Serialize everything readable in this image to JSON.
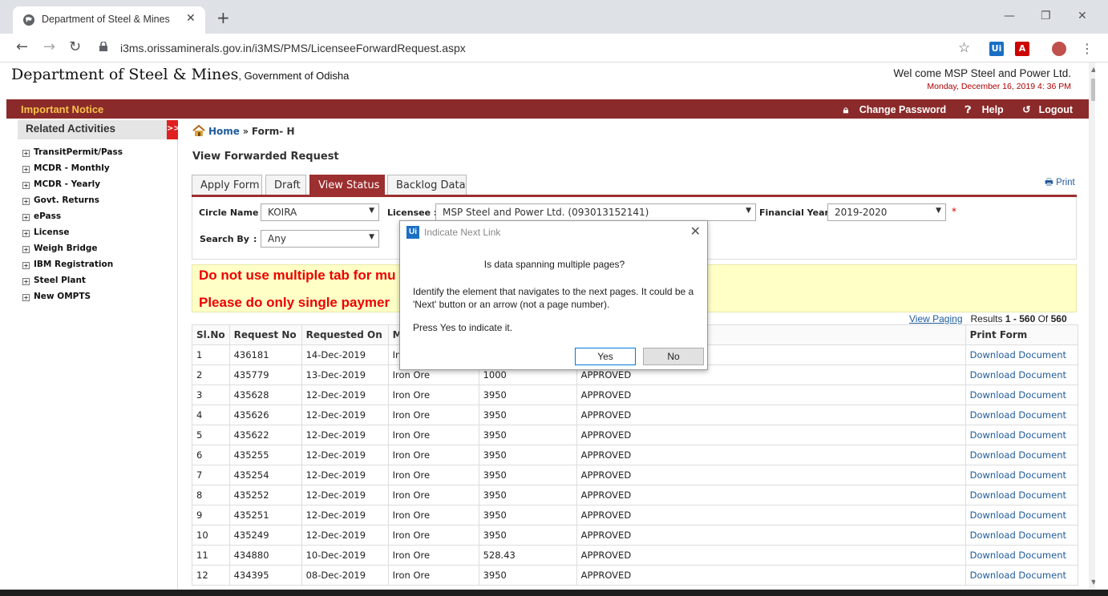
{
  "browser": {
    "tab_title": "Department of Steel & Mines",
    "url": "i3ms.orissaminerals.gov.in/i3MS/PMS/LicenseeForwardRequest.aspx"
  },
  "header": {
    "site_title": "Department of Steel & Mines",
    "site_sub": ", Government of Odisha",
    "welcome": "Wel come MSP Steel and Power Ltd.",
    "date": "Monday, December 16, 2019  4: 36 PM"
  },
  "redbar": {
    "notice": "Important Notice",
    "change_password": "Change Password",
    "help": "Help",
    "logout": "Logout"
  },
  "sidebar": {
    "heading": "Related Activities",
    "toggle": ">>",
    "items": [
      "TransitPermit/Pass",
      "MCDR - Monthly",
      "MCDR - Yearly",
      "Govt. Returns",
      "ePass",
      "License",
      "Weigh Bridge",
      "IBM Registration",
      "Steel Plant",
      "New OMPTS"
    ]
  },
  "breadcrumb": {
    "home": "Home",
    "sep": " » ",
    "current": "Form- H"
  },
  "page_title": "View Forwarded Request",
  "tabs": [
    "Apply Form",
    "Draft",
    "View Status",
    "Backlog Data"
  ],
  "print": "Print",
  "filters": {
    "circle_label": "Circle Name :",
    "circle_value": "KOIRA",
    "licensee_label": "Licensee :",
    "licensee_value": "MSP Steel and Power Ltd. (093013152141)",
    "fy_label": "Financial Year :",
    "fy_value": "2019-2020",
    "search_label": "Search By",
    "search_colon": ":",
    "search_value": "Any",
    "required": "*"
  },
  "warnings": {
    "line1": "Do not use multiple tab for mu",
    "line2": "Please do only single paymer"
  },
  "results": {
    "view_paging": "View Paging",
    "prefix": "Results",
    "from": "1",
    "dash": " - ",
    "to": "560",
    "of": "Of",
    "total": "560"
  },
  "table": {
    "headers": [
      "Sl.No",
      "Request No",
      "Requested On",
      "M",
      "",
      "",
      "Print Form"
    ],
    "rows": [
      [
        "1",
        "436181",
        "14-Dec-2019",
        "Ir",
        "",
        "",
        "Download Document"
      ],
      [
        "2",
        "435779",
        "13-Dec-2019",
        "Iron Ore",
        "1000",
        "APPROVED",
        "Download Document"
      ],
      [
        "3",
        "435628",
        "12-Dec-2019",
        "Iron Ore",
        "3950",
        "APPROVED",
        "Download Document"
      ],
      [
        "4",
        "435626",
        "12-Dec-2019",
        "Iron Ore",
        "3950",
        "APPROVED",
        "Download Document"
      ],
      [
        "5",
        "435622",
        "12-Dec-2019",
        "Iron Ore",
        "3950",
        "APPROVED",
        "Download Document"
      ],
      [
        "6",
        "435255",
        "12-Dec-2019",
        "Iron Ore",
        "3950",
        "APPROVED",
        "Download Document"
      ],
      [
        "7",
        "435254",
        "12-Dec-2019",
        "Iron Ore",
        "3950",
        "APPROVED",
        "Download Document"
      ],
      [
        "8",
        "435252",
        "12-Dec-2019",
        "Iron Ore",
        "3950",
        "APPROVED",
        "Download Document"
      ],
      [
        "9",
        "435251",
        "12-Dec-2019",
        "Iron Ore",
        "3950",
        "APPROVED",
        "Download Document"
      ],
      [
        "10",
        "435249",
        "12-Dec-2019",
        "Iron Ore",
        "3950",
        "APPROVED",
        "Download Document"
      ],
      [
        "11",
        "434880",
        "10-Dec-2019",
        "Iron Ore",
        "528.43",
        "APPROVED",
        "Download Document"
      ],
      [
        "12",
        "434395",
        "08-Dec-2019",
        "Iron Ore",
        "3950",
        "APPROVED",
        "Download Document"
      ]
    ]
  },
  "dialog": {
    "icon": "Ui",
    "title": "Indicate Next Link",
    "question": "Is data spanning multiple pages?",
    "desc": "Identify the element that navigates to the next pages. It could be a 'Next' button or an arrow (not a page number).",
    "prompt": "Press Yes to indicate it.",
    "yes": "Yes",
    "no": "No"
  },
  "extensions": {
    "ui": "Ui"
  }
}
